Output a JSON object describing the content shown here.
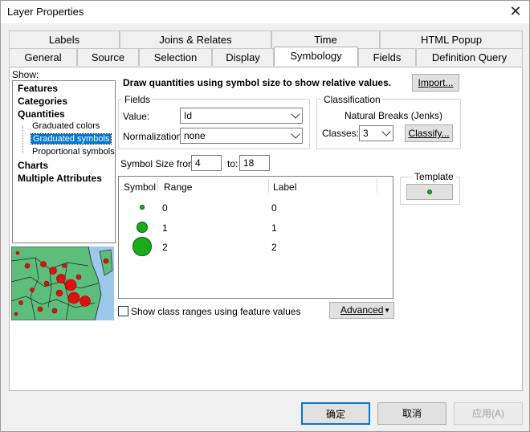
{
  "window": {
    "title": "Layer Properties"
  },
  "tabs_row1": [
    "Labels",
    "Joins & Relates",
    "Time",
    "HTML Popup"
  ],
  "tabs_row2": [
    "General",
    "Source",
    "Selection",
    "Display",
    "Symbology",
    "Fields",
    "Definition Query"
  ],
  "active_tab": "Symbology",
  "show": {
    "label": "Show:",
    "items": [
      "Features",
      "Categories",
      "Quantities",
      "Graduated colors",
      "Graduated symbols",
      "Proportional symbols",
      "Charts",
      "Multiple Attributes"
    ],
    "selected": "Graduated symbols"
  },
  "description": "Draw quantities using symbol size to show relative values.",
  "import_label": "Import...",
  "fields": {
    "legend": "Fields",
    "value_label": "Value:",
    "value": "Id",
    "normalization_label": "Normalization:",
    "normalization": "none"
  },
  "classification": {
    "legend": "Classification",
    "method": "Natural Breaks (Jenks)",
    "classes_label": "Classes:",
    "classes": "3",
    "classify_label": "Classify..."
  },
  "symbol_size": {
    "from_label": "Symbol Size from:",
    "from": "4",
    "to_label": "to:",
    "to": "18"
  },
  "template": {
    "label": "Template"
  },
  "table": {
    "headers": [
      "Symbol",
      "Range",
      "Label"
    ],
    "rows": [
      {
        "range": "0",
        "label": "0",
        "size": 4
      },
      {
        "range": "1",
        "label": "1",
        "size": 11
      },
      {
        "range": "2",
        "label": "2",
        "size": 18
      }
    ]
  },
  "show_ranges_label": "Show class ranges using feature values",
  "advanced_label": "Advanced",
  "buttons": {
    "ok": "确定",
    "cancel": "取消",
    "apply": "应用(A)"
  },
  "colors": {
    "symbol_fill": "#1aad1a",
    "selection": "#0078d7"
  }
}
